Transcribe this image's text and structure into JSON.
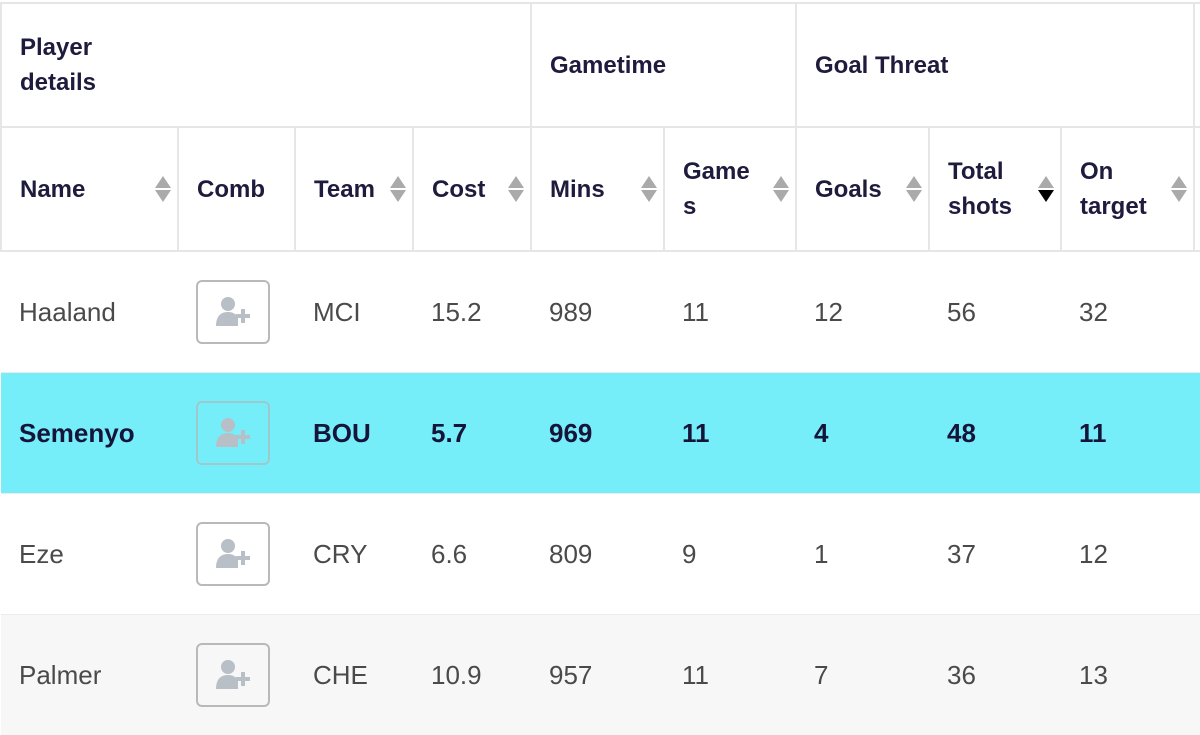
{
  "groups": [
    {
      "label": "Player details"
    },
    {
      "label": "Gametime"
    },
    {
      "label": "Goal Threat"
    }
  ],
  "columns": [
    {
      "key": "name",
      "label": "Name",
      "sortable": true,
      "sort": "none"
    },
    {
      "key": "comb",
      "label": "Comb",
      "sortable": false,
      "sort": "none"
    },
    {
      "key": "team",
      "label": "Team",
      "sortable": true,
      "sort": "none"
    },
    {
      "key": "cost",
      "label": "Cost",
      "sortable": true,
      "sort": "none"
    },
    {
      "key": "mins",
      "label": "Mins",
      "sortable": true,
      "sort": "none"
    },
    {
      "key": "games",
      "label": "Game s",
      "sortable": true,
      "sort": "none"
    },
    {
      "key": "goals",
      "label": "Goals",
      "sortable": true,
      "sort": "none"
    },
    {
      "key": "total_shots",
      "label": "Total shots",
      "sortable": true,
      "sort": "descending"
    },
    {
      "key": "on_target",
      "label": "On target",
      "sortable": true,
      "sort": "none"
    }
  ],
  "rows": [
    {
      "name": "Haaland",
      "team": "MCI",
      "cost": "15.2",
      "mins": "989",
      "games": "11",
      "goals": "12",
      "total_shots": "56",
      "on_target": "32",
      "highlighted": false
    },
    {
      "name": "Semenyo",
      "team": "BOU",
      "cost": "5.7",
      "mins": "969",
      "games": "11",
      "goals": "4",
      "total_shots": "48",
      "on_target": "11",
      "highlighted": true
    },
    {
      "name": "Eze",
      "team": "CRY",
      "cost": "6.6",
      "mins": "809",
      "games": "9",
      "goals": "1",
      "total_shots": "37",
      "on_target": "12",
      "highlighted": false
    },
    {
      "name": "Palmer",
      "team": "CHE",
      "cost": "10.9",
      "mins": "957",
      "games": "11",
      "goals": "7",
      "total_shots": "36",
      "on_target": "13",
      "highlighted": false
    }
  ],
  "icons": {
    "comb_button": "add-user-icon",
    "sort": "sort-arrows-icon"
  },
  "colors": {
    "highlight": "#76eefa",
    "header_text": "#1e1b3d",
    "body_text": "#4a4a4a",
    "border": "#e6e6e6",
    "sort_active": "#000000",
    "sort_inactive": "#aaaaaa"
  }
}
